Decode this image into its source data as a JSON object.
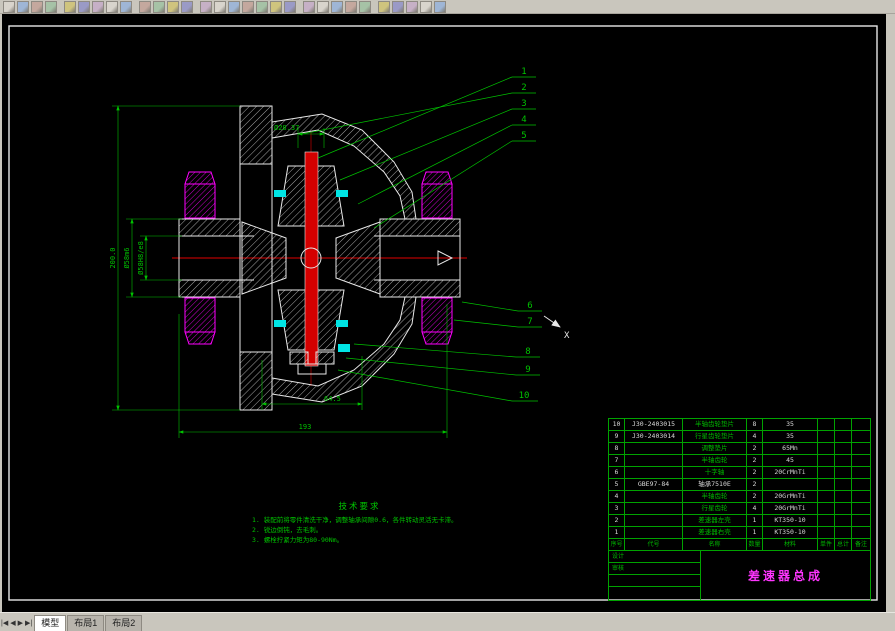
{
  "toolbar": {
    "icons": [
      "new",
      "open",
      "save",
      "print",
      "cut",
      "copy",
      "paste",
      "undo",
      "redo",
      "zoom-in",
      "zoom-out",
      "pan",
      "layers",
      "line",
      "polyline",
      "circle",
      "arc",
      "rectangle",
      "hatch",
      "text",
      "dimension",
      "move",
      "rotate",
      "mirror",
      "erase",
      "properties",
      "osnap",
      "grid",
      "ortho",
      "help"
    ]
  },
  "tabs": {
    "model": "模型",
    "layout1": "布局1",
    "layout2": "布局2"
  },
  "drawing": {
    "callouts": [
      "1",
      "2",
      "3",
      "4",
      "5",
      "6",
      "7",
      "8",
      "9",
      "10"
    ],
    "section_label": "X",
    "dims": {
      "top": "Ø28.37",
      "left_overall": "200.0",
      "left_outer": "Ø58m6",
      "left_bore": "Ø58H8/e8",
      "bottom_inner": "64.5",
      "bottom_overall": "193"
    },
    "tech": {
      "title": "技术要求",
      "l1": "1. 装配前将零件清洗干净，调整轴承间隙0.6，各件转动灵活无卡滞。",
      "l2": "2. 锐边倒钝，去毛刺。",
      "l3": "3. 螺栓拧紧力矩为80-90Nm。"
    }
  },
  "bom": {
    "headers": [
      "序号",
      "代号",
      "名称",
      "数量",
      "材料",
      "单件",
      "总计",
      "备注"
    ],
    "rows": [
      {
        "no": "10",
        "code": "J30-2403015",
        "name": "半轴齿轮垫片",
        "qty": "8",
        "material": "35"
      },
      {
        "no": "9",
        "code": "J30-2403014",
        "name": "行星齿轮垫片",
        "qty": "4",
        "material": "35"
      },
      {
        "no": "8",
        "code": "",
        "name": "调整垫片",
        "qty": "2",
        "material": "65Mn"
      },
      {
        "no": "7",
        "code": "",
        "name": "半轴齿轮",
        "qty": "2",
        "material": "45"
      },
      {
        "no": "6",
        "code": "",
        "name": "十字轴",
        "qty": "2",
        "material": "20CrMnTi"
      },
      {
        "no": "5",
        "code": "GBE97-84",
        "name": "轴承7510E",
        "qty": "2",
        "material": "",
        "name_color": "white"
      },
      {
        "no": "4",
        "code": "",
        "name": "半轴齿轮",
        "qty": "2",
        "material": "20GrMnTi"
      },
      {
        "no": "3",
        "code": "",
        "name": "行星齿轮",
        "qty": "4",
        "material": "20GrMnTi"
      },
      {
        "no": "2",
        "code": "",
        "name": "差速器左壳",
        "qty": "1",
        "material": "KT350-10"
      },
      {
        "no": "1",
        "code": "",
        "name": "差速器右壳",
        "qty": "1",
        "material": "KT350-10"
      }
    ],
    "title_block": {
      "title": "差速器总成",
      "labels": [
        "设计",
        "审核"
      ]
    }
  }
}
